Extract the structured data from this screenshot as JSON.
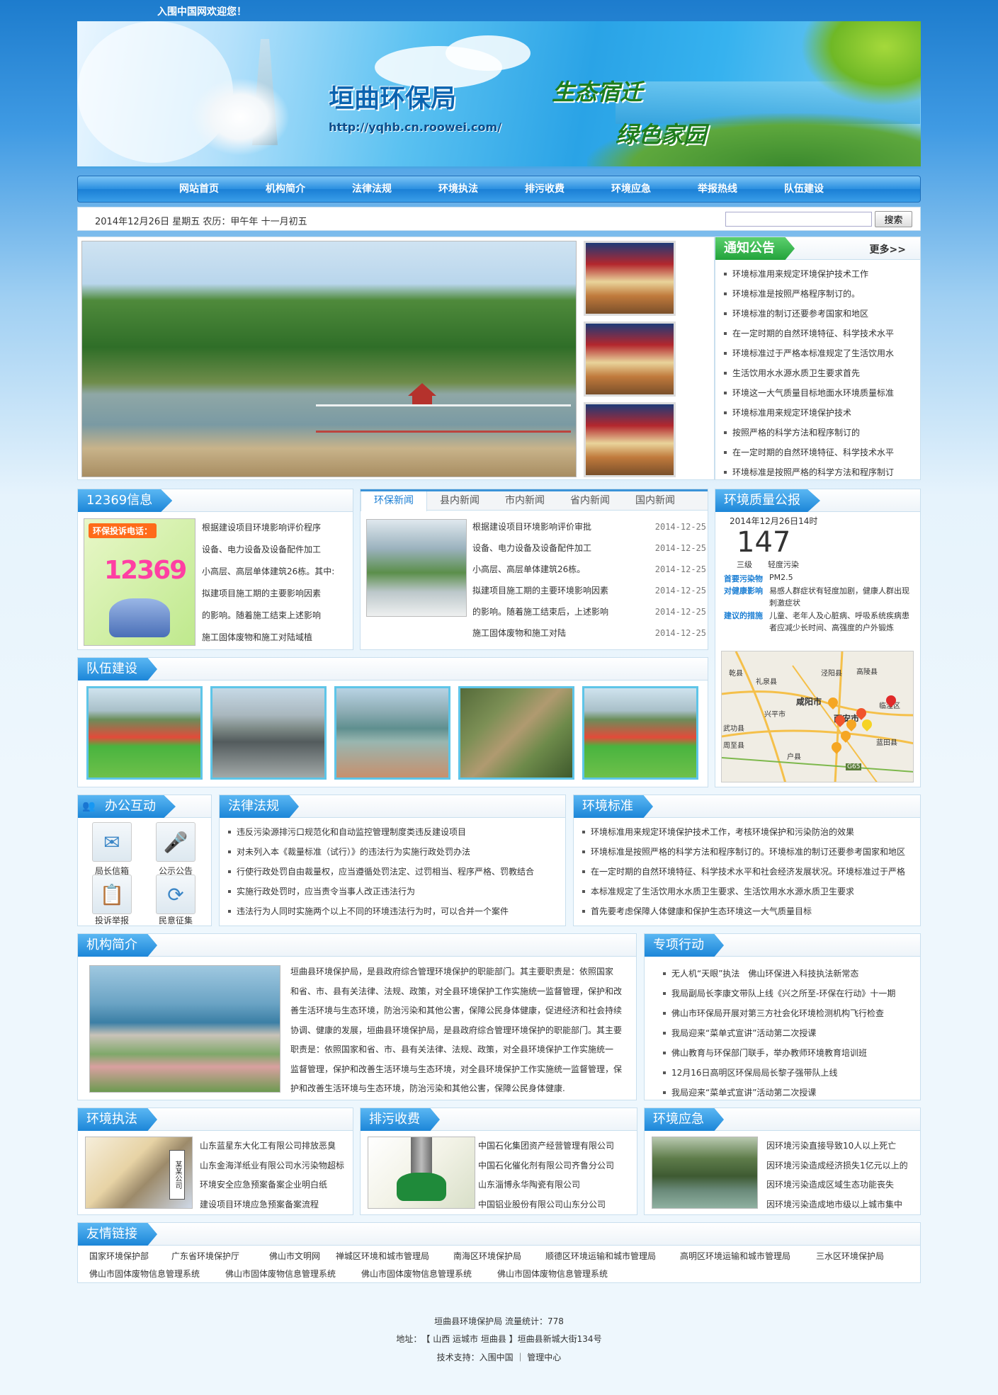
{
  "top": {
    "welcome": "入围中国网欢迎您！"
  },
  "banner": {
    "title": "垣曲环保局",
    "url": "http://yqhb.cn.roowei.com/",
    "slogan1": "生态宿迁",
    "slogan2": "绿色家园"
  },
  "nav": [
    "网站首页",
    "机构简介",
    "法律法规",
    "环境执法",
    "排污收费",
    "环境应急",
    "举报热线",
    "队伍建设"
  ],
  "datebar": {
    "date": "2014年12月26日 星期五 农历：甲午年 十一月初五",
    "search_button": "搜索",
    "search_value": ""
  },
  "notice": {
    "title": "通知公告",
    "more": "更多>>",
    "items": [
      "环境标准用来规定环境保护技术工作",
      "环境标准是按照严格程序制订的。",
      "环境标准的制订还要参考国家和地区",
      "在一定时期的自然环境特征、科学技术水平",
      "环境标准过于严格本标准规定了生活饮用水",
      "生活饮用水水源水质卫生要求首先",
      "环境这一大气质量目标地面水环境质量标准",
      "环境标准用来规定环境保护技术",
      "按照严格的科学方法和程序制订的",
      "在一定时期的自然环境特征、科学技术水平",
      "环境标准是按照严格的科学方法和程序制订"
    ]
  },
  "info12369": {
    "title": "12369信息",
    "image_text_top": "环保投诉电话：",
    "image_number": "12369",
    "lines": [
      "根据建设项目环境影响评价程序",
      "设备、电力设备及设备配件加工",
      "小高层、高层单体建筑26栋。其中:",
      "拟建项目施工期的主要影响因素",
      "的影响。随着施工结束上述影响",
      "施工固体废物和施工对陆域植"
    ]
  },
  "news": {
    "tabs": [
      "环保新闻",
      "县内新闻",
      "市内新闻",
      "省内新闻",
      "国内新闻"
    ],
    "items": [
      {
        "text": "根据建设项目环境影响评价审批",
        "date": "2014-12-25"
      },
      {
        "text": "设备、电力设备及设备配件加工",
        "date": "2014-12-25"
      },
      {
        "text": "小高层、高层单体建筑26栋。",
        "date": "2014-12-25"
      },
      {
        "text": "拟建项目施工期的主要环境影响因素",
        "date": "2014-12-25"
      },
      {
        "text": "的影响。随着施工结束后，上述影响",
        "date": "2014-12-25"
      },
      {
        "text": "施工固体废物和施工对陆",
        "date": "2014-12-25"
      }
    ]
  },
  "quality": {
    "title": "环境质量公报",
    "time": "2014年12月26日14时",
    "aqi": "147",
    "level": "三级",
    "level_desc": "轻度污染",
    "primary_label": "首要污染物",
    "primary_value": "PM2.5",
    "health_label": "对健康影响",
    "health_value": "易感人群症状有轻度加剧，健康人群出现刺激症状",
    "measure_label": "建议的措施",
    "measure_value": "儿童、老年人及心脏病、呼吸系统疾病患者应减少长时间、高强度的户外锻炼",
    "map_labels": [
      "乾县",
      "礼泉县",
      "泾阳县",
      "高陵县",
      "咸阳市",
      "西安市",
      "兴平市",
      "临潼区",
      "武功县",
      "周至县",
      "户县",
      "蓝田县",
      "G65"
    ],
    "colors": {
      "level": "#f2a31b",
      "label": "#1c7fd4"
    }
  },
  "team": {
    "title": "队伍建设"
  },
  "office": {
    "title": "办公互动",
    "items": [
      {
        "label": "局长信箱",
        "icon": "mail-icon"
      },
      {
        "label": "公示公告",
        "icon": "microphone-icon"
      },
      {
        "label": "投诉举报",
        "icon": "document-icon"
      },
      {
        "label": "民意征集",
        "icon": "refresh-icon"
      }
    ]
  },
  "law": {
    "title": "法律法规",
    "items": [
      "违反污染源排污口规范化和自动监控管理制度类违反建设项目",
      "对未列入本《裁量标准（试行）》的违法行为实施行政处罚办法",
      "行使行政处罚自由裁量权，应当遵循处罚法定、过罚相当、程序严格、罚教结合",
      "实施行政处罚时，应当责令当事人改正违法行为",
      "违法行为人同时实施两个以上不同的环境违法行为时，可以合并一个案件"
    ]
  },
  "standard": {
    "title": "环境标准",
    "items": [
      "环境标准用来规定环境保护技术工作，考核环境保护和污染防治的效果",
      "环境标准是按照严格的科学方法和程序制订的。环境标准的制订还要参考国家和地区",
      "在一定时期的自然环境特征、科学技术水平和社会经济发展状况。环境标准过于严格",
      "本标准规定了生活饮用水水质卫生要求、生活饮用水水源水质卫生要求",
      "首先要考虑保障人体健康和保护生态环境这一大气质量目标"
    ]
  },
  "org": {
    "title": "机构简介",
    "lines": [
      "垣曲县环境保护局，是县政府综合管理环境保护的职能部门。其主要职责是：依照国家",
      "和省、市、县有关法律、法规、政策，对全县环境保护工作实施统一监督管理，保护和改",
      "善生活环境与生态环境，防治污染和其他公害，保障公民身体健康，促进经济和社会持续",
      "协调、健康的发展，垣曲县环境保护局，是县政府综合管理环境保护的职能部门。其主要",
      "职责是：依照国家和省、市、县有关法律、法规、政策，对全县环境保护工作实施统一",
      "监督管理，保护和改善生活环境与生态环境，对全县环境保护工作实施统一监督管理，保",
      "护和改善生活环境与生态环境，防治污染和其他公害，保障公民身体健康."
    ]
  },
  "special": {
    "title": "专项行动",
    "items": [
      "无人机“天眼”执法　佛山环保进入科技执法新常态",
      "我局副局长李康文带队上线《兴之所至-环保在行动》十一期",
      "佛山市环保局开展对第三方社会化环境检测机构飞行检查",
      "我局迎来“菜单式宣讲”活动第二次授课",
      "佛山教育与环保部门联手，举办教师环境教育培训班",
      "12月16日高明区环保局局长黎子强带队上线",
      "我局迎来“菜单式宣讲”活动第二次授课"
    ]
  },
  "enforce": {
    "title": "环境执法",
    "sign": "某某公司",
    "items": [
      "山东蓝星东大化工有限公司排放恶臭",
      "山东金海洋纸业有限公司水污染物超标",
      "环境安全应急预案备案企业明白纸",
      "建设项目环境应急预案备案流程"
    ]
  },
  "fee": {
    "title": "排污收费",
    "items": [
      "中国石化集团资产经营管理有限公司",
      "中国石化催化剂有限公司齐鲁分公司",
      "山东淄博永华陶瓷有限公司",
      "中国铝业股份有限公司山东分公司"
    ]
  },
  "emergency": {
    "title": "环境应急",
    "items": [
      "因环境污染直接导致10人以上死亡",
      "因环境污染造成经济损失1亿元以上的",
      "因环境污染造成区域生态功能丧失",
      "因环境污染造成地市级以上城市集中"
    ]
  },
  "links": {
    "title": "友情链接",
    "row1": [
      "国家环境保护部",
      "广东省环境保护厅",
      "佛山市文明网",
      "禅城区环境和城市管理局",
      "南海区环境保护局",
      "顺德区环境运输和城市管理局",
      "高明区环境运输和城市管理局",
      "三水区环境保护局"
    ],
    "row2": [
      "佛山市固体废物信息管理系统",
      "佛山市固体废物信息管理系统",
      "佛山市固体废物信息管理系统",
      "佛山市固体废物信息管理系统"
    ]
  },
  "footer": {
    "line1": "垣曲县环境保护局 流量统计：778",
    "line2": "地址：　【 山西  运城市  垣曲县  】垣曲县新城大街134号",
    "line3": "技术支持：入围中国 ｜ 管理中心"
  }
}
